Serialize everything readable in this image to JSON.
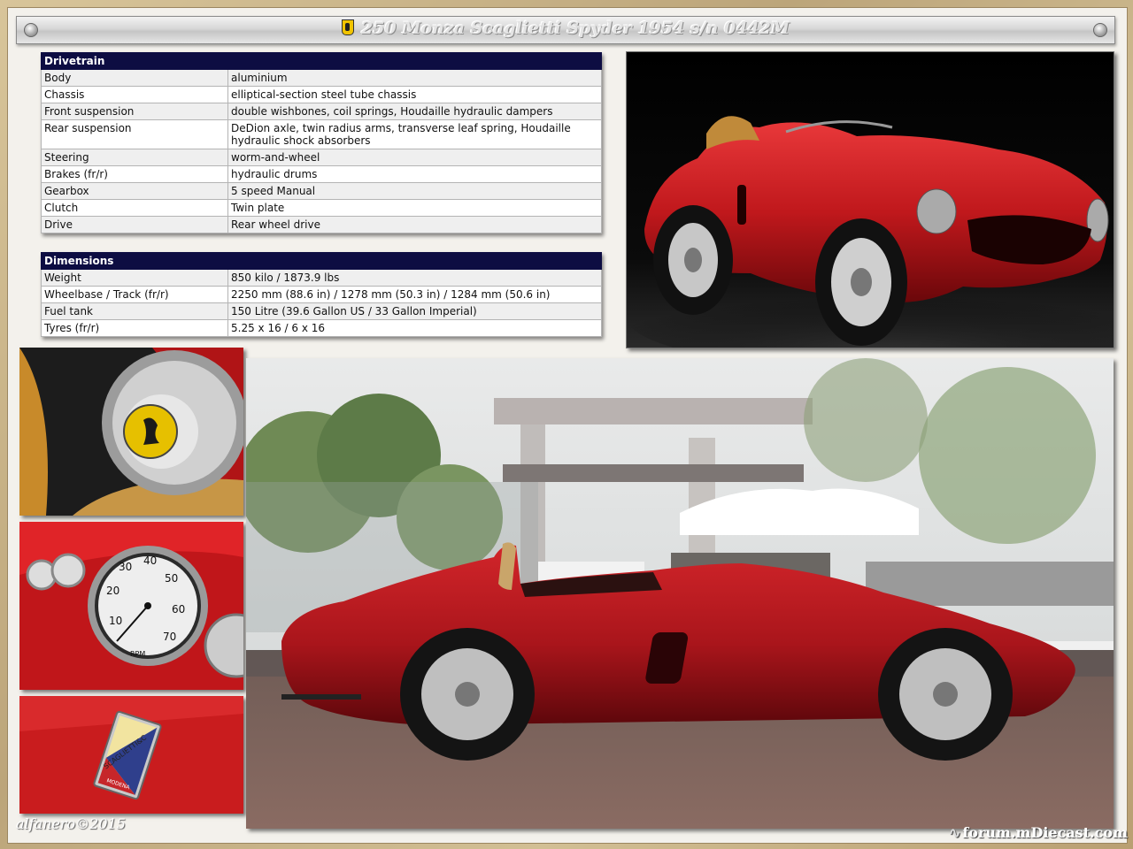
{
  "title": "250 Monza Scaglietti Spyder 1954  s/n 0442M",
  "drivetrain": {
    "heading": "Drivetrain",
    "rows": [
      {
        "key": "Body",
        "value": "aluminium"
      },
      {
        "key": "Chassis",
        "value": "elliptical-section steel tube chassis"
      },
      {
        "key": "Front suspension",
        "value": "double wishbones, coil springs, Houdaille hydraulic dampers"
      },
      {
        "key": "Rear suspension",
        "value": "DeDion axle, twin radius arms, transverse leaf spring, Houdaille hydraulic shock absorbers"
      },
      {
        "key": "Steering",
        "value": "worm-and-wheel"
      },
      {
        "key": "Brakes (fr/r)",
        "value": "hydraulic drums"
      },
      {
        "key": "Gearbox",
        "value": "5 speed Manual"
      },
      {
        "key": "Clutch",
        "value": "Twin plate"
      },
      {
        "key": "Drive",
        "value": "Rear wheel drive"
      }
    ]
  },
  "dimensions": {
    "heading": "Dimensions",
    "rows": [
      {
        "key": "Weight",
        "value": "850 kilo / 1873.9 lbs"
      },
      {
        "key": "Wheelbase / Track (fr/r)",
        "value": "2250 mm (88.6 in) / 1278 mm (50.3 in) / 1284 mm (50.6 in)"
      },
      {
        "key": "Fuel tank",
        "value": "150 Litre (39.6 Gallon US / 33 Gallon Imperial)"
      },
      {
        "key": "Tyres (fr/r)",
        "value": "5.25 x 16 / 6 x 16"
      }
    ]
  },
  "gauge": {
    "numbers": [
      "10",
      "20",
      "30",
      "40",
      "50",
      "60",
      "70"
    ],
    "unit": "RPM"
  },
  "badge": {
    "brand": "SCAGLIETTI&C",
    "city": "MODENA"
  },
  "signature": "alfanero©2015",
  "watermark": "forum.mDiecast.com",
  "colors": {
    "table_header": "#0d0d42",
    "car_red": "#b8161c",
    "frame_gold": "#c9b489"
  }
}
